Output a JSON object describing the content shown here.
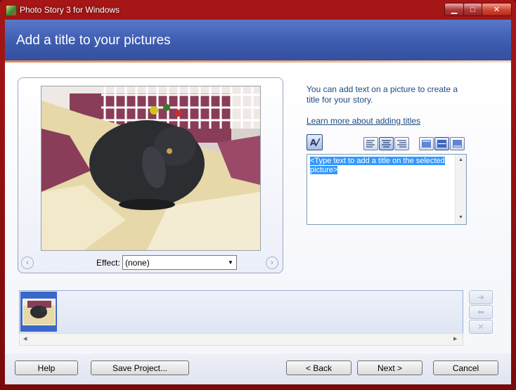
{
  "window": {
    "title": "Photo Story 3 for Windows",
    "controls": {
      "minimize": "▁",
      "maximize": "□",
      "close": "✕"
    }
  },
  "header": {
    "title": "Add a title to your pictures"
  },
  "preview": {
    "effect_label": "Effect:",
    "effect_value": "(none)",
    "prev_icon": "‹",
    "next_icon": "›"
  },
  "panel": {
    "info_text": "You can add text on a picture to create a title for your story.",
    "learn_link": "Learn more about adding titles",
    "textbox_selected_text": "<Type text to add a title on the selected picture>",
    "tools": [
      "font-icon",
      "align-left-icon",
      "align-center-icon",
      "align-right-icon",
      "valign-top-icon",
      "valign-middle-icon",
      "valign-bottom-icon"
    ]
  },
  "filmstrip": {
    "side_buttons": {
      "right": "➜",
      "left": "⬅",
      "remove": "✕"
    }
  },
  "buttons": {
    "help": "Help",
    "save_project": "Save Project...",
    "back": "< Back",
    "next": "Next >",
    "cancel": "Cancel"
  },
  "colors": {
    "frame": "#a61616",
    "header": "#3e5cb0",
    "accent_stripe": "#e58a52",
    "link": "#1e4a82",
    "selection": "#3399ff"
  }
}
